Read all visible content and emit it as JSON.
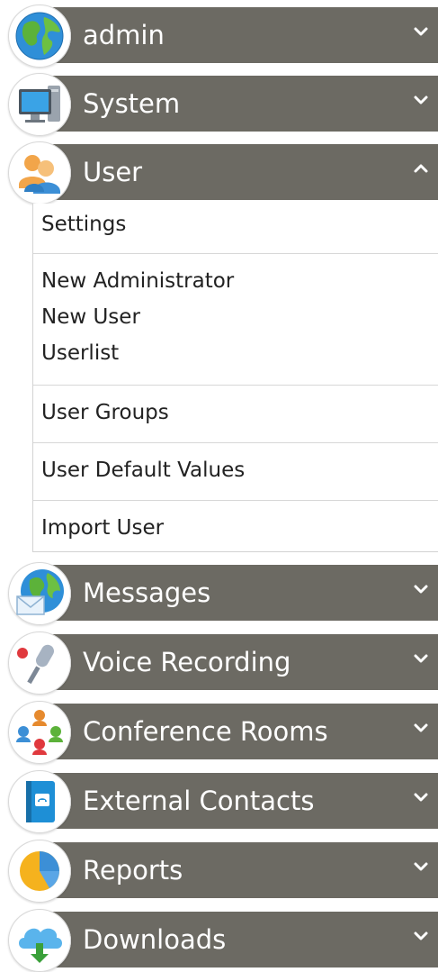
{
  "colors": {
    "header_bg": "#6c6a63",
    "header_text": "#ffffff",
    "submenu_text": "#222222",
    "divider": "#d7d7d7"
  },
  "menu": {
    "admin": {
      "label": "admin",
      "icon": "globe-icon",
      "state": "collapsed"
    },
    "system": {
      "label": "System",
      "icon": "computer-icon",
      "state": "collapsed"
    },
    "user": {
      "label": "User",
      "icon": "users-icon",
      "state": "expanded"
    },
    "messages": {
      "label": "Messages",
      "icon": "globe-mail-icon",
      "state": "collapsed"
    },
    "voice": {
      "label": "Voice Recording",
      "icon": "microphone-icon",
      "state": "collapsed"
    },
    "conference": {
      "label": "Conference Rooms",
      "icon": "people-circle-icon",
      "state": "collapsed"
    },
    "contacts": {
      "label": "External Contacts",
      "icon": "address-book-icon",
      "state": "collapsed"
    },
    "reports": {
      "label": "Reports",
      "icon": "pie-chart-icon",
      "state": "collapsed"
    },
    "downloads": {
      "label": "Downloads",
      "icon": "cloud-download-icon",
      "state": "collapsed"
    }
  },
  "user_submenu": {
    "settings": "Settings",
    "new_administrator": "New Administrator",
    "new_user": "New User",
    "userlist": "Userlist",
    "user_groups": "User Groups",
    "user_default_values": "User Default Values",
    "import_user": "Import User"
  }
}
